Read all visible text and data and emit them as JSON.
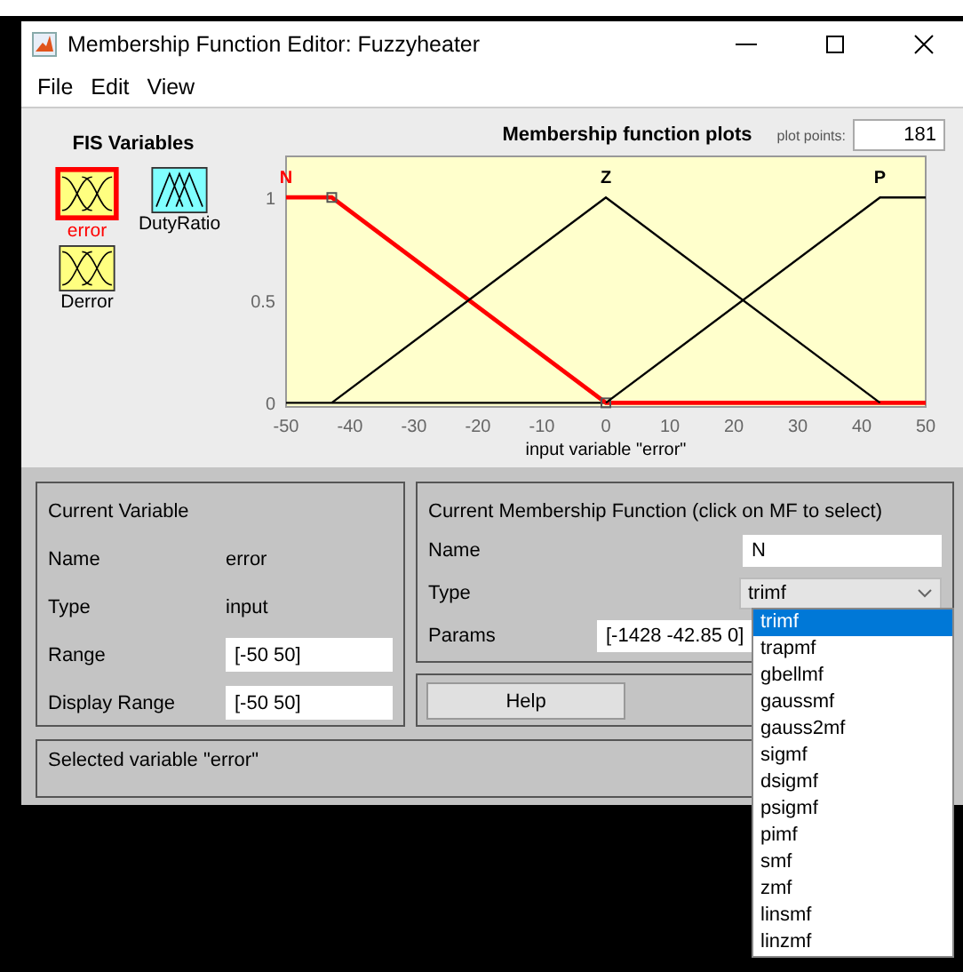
{
  "window": {
    "title": "Membership Function Editor: Fuzzyheater"
  },
  "menu": [
    "File",
    "Edit",
    "View"
  ],
  "fis_variables": {
    "title": "FIS Variables",
    "items": [
      {
        "name": "error",
        "kind": "input",
        "selected": true
      },
      {
        "name": "DutyRatio",
        "kind": "output",
        "selected": false
      },
      {
        "name": "Derror",
        "kind": "input",
        "selected": false
      }
    ]
  },
  "plot": {
    "plot_points_label": "plot points:",
    "plot_points": "181",
    "chart_data": {
      "type": "line",
      "title": "Membership function plots",
      "xlabel": "input variable \"error\"",
      "x": [
        -50,
        -42.85,
        0,
        42.85,
        50
      ],
      "series": [
        {
          "name": "N",
          "color": "#ff0000",
          "values": [
            1,
            1,
            0,
            0,
            0
          ]
        },
        {
          "name": "Z",
          "color": "#000000",
          "values": [
            null,
            0,
            1,
            0,
            null
          ]
        },
        {
          "name": "P",
          "color": "#000000",
          "values": [
            null,
            null,
            0,
            1,
            1
          ]
        }
      ],
      "xlim": [
        -50,
        50
      ],
      "ylim": [
        -0.02,
        1.2
      ],
      "xticks": [
        -50,
        -40,
        -30,
        -20,
        -10,
        0,
        10,
        20,
        30,
        40,
        50
      ],
      "yticks": [
        0,
        0.5,
        1
      ]
    },
    "membership_functions": [
      {
        "selected": true
      },
      {
        "selected": false
      },
      {
        "selected": false
      }
    ]
  },
  "current_variable": {
    "title": "Current Variable",
    "rows": [
      {
        "label": "Name",
        "value": "error",
        "kind": "text"
      },
      {
        "label": "Type",
        "value": "input",
        "kind": "text"
      },
      {
        "label": "Range",
        "value": "[-50 50]",
        "kind": "field"
      },
      {
        "label": "Display Range",
        "value": "[-50 50]",
        "kind": "field"
      }
    ]
  },
  "current_mf": {
    "title": "Current Membership Function (click on MF to select)",
    "name_label": "Name",
    "name": "N",
    "type_label": "Type",
    "type": "trimf",
    "params_label": "Params",
    "params": "[-1428 -42.85 0]",
    "expanded": true,
    "type_options": [
      {
        "label": "trimf",
        "selected": true
      },
      {
        "label": "trapmf",
        "selected": false
      },
      {
        "label": "gbellmf",
        "selected": false
      },
      {
        "label": "gaussmf",
        "selected": false
      },
      {
        "label": "gauss2mf",
        "selected": false
      },
      {
        "label": "sigmf",
        "selected": false
      },
      {
        "label": "dsigmf",
        "selected": false
      },
      {
        "label": "psigmf",
        "selected": false
      },
      {
        "label": "pimf",
        "selected": false
      },
      {
        "label": "smf",
        "selected": false
      },
      {
        "label": "zmf",
        "selected": false
      },
      {
        "label": "linsmf",
        "selected": false
      },
      {
        "label": "linzmf",
        "selected": false
      }
    ]
  },
  "help_button": "Help",
  "status": "Selected variable \"error\""
}
